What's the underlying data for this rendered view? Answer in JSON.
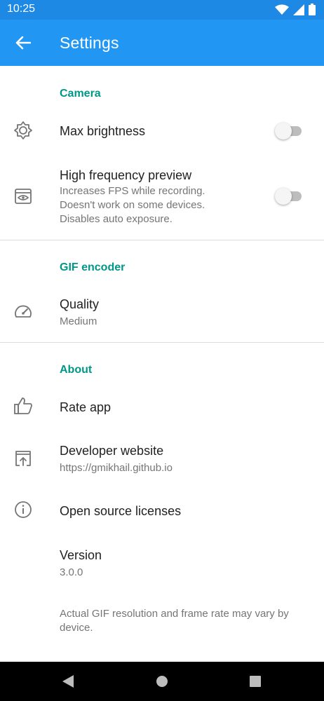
{
  "status_bar": {
    "time": "10:25"
  },
  "app_bar": {
    "title": "Settings"
  },
  "sections": {
    "camera": {
      "header": "Camera",
      "max_brightness": {
        "title": "Max brightness",
        "enabled": false
      },
      "high_frequency_preview": {
        "title": "High frequency preview",
        "summary_lines": [
          "Increases FPS while recording.",
          "Doesn't work on some devices.",
          "Disables auto exposure."
        ],
        "enabled": false
      }
    },
    "gif_encoder": {
      "header": "GIF encoder",
      "quality": {
        "title": "Quality",
        "summary": "Medium"
      }
    },
    "about": {
      "header": "About",
      "rate_app": {
        "title": "Rate app"
      },
      "developer_website": {
        "title": "Developer website",
        "summary": "https://gmikhail.github.io"
      },
      "licenses": {
        "title": "Open source licenses"
      },
      "version": {
        "title": "Version",
        "summary": "3.0.0"
      }
    }
  },
  "footer_note": "Actual GIF resolution and frame rate may vary by device.",
  "colors": {
    "app_bar": "#2196f3",
    "status_bar": "#1e88e5",
    "accent": "#009688",
    "text_secondary": "#757575"
  },
  "icons": [
    "arrow-back-icon",
    "brightness-icon",
    "preview-icon",
    "speed-gauge-icon",
    "thumb-up-icon",
    "open-in-browser-icon",
    "info-icon"
  ]
}
